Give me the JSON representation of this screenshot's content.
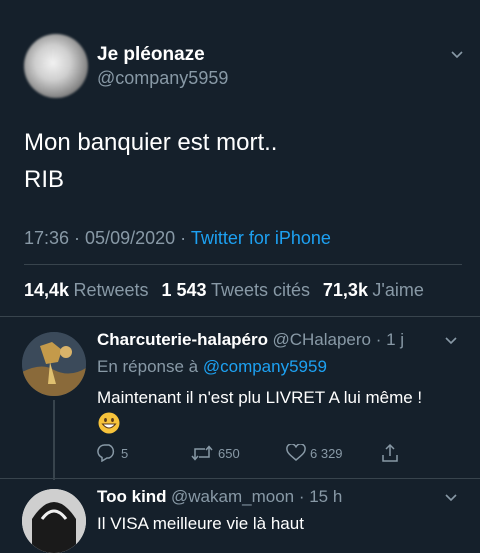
{
  "tweet": {
    "author_name": "Je pléonaze",
    "author_handle": "@company5959",
    "text_line1": "Mon banquier est mort..",
    "text_line2": "RIB",
    "time": "17:36 · 05/09/2020 · ",
    "source": "Twitter for iPhone"
  },
  "stats": {
    "retweets_count": "14,4k",
    "retweets_label": "Retweets",
    "quotes_count": "1 543",
    "quotes_label": "Tweets cités",
    "likes_count": "71,3k",
    "likes_label": "J'aime"
  },
  "reply1": {
    "name": "Charcuterie-halapéro",
    "handle_time": "@CHalapero · 1 j",
    "in_reply_prefix": "En réponse à ",
    "in_reply_handle": "@company5959",
    "text": "Maintenant il n'est plu LIVRET A lui même !",
    "emoji": "grinning-face-emoji",
    "reply_count": "5",
    "retweet_count": "650",
    "like_count": "6 329"
  },
  "reply2": {
    "name": "Too kind",
    "handle_time": "@wakam_moon · 15 h",
    "text": "Il VISA meilleure vie là haut"
  },
  "colors": {
    "background": "#15202b",
    "muted": "#8899a6",
    "link": "#1da1f2",
    "divider": "#38444d"
  }
}
